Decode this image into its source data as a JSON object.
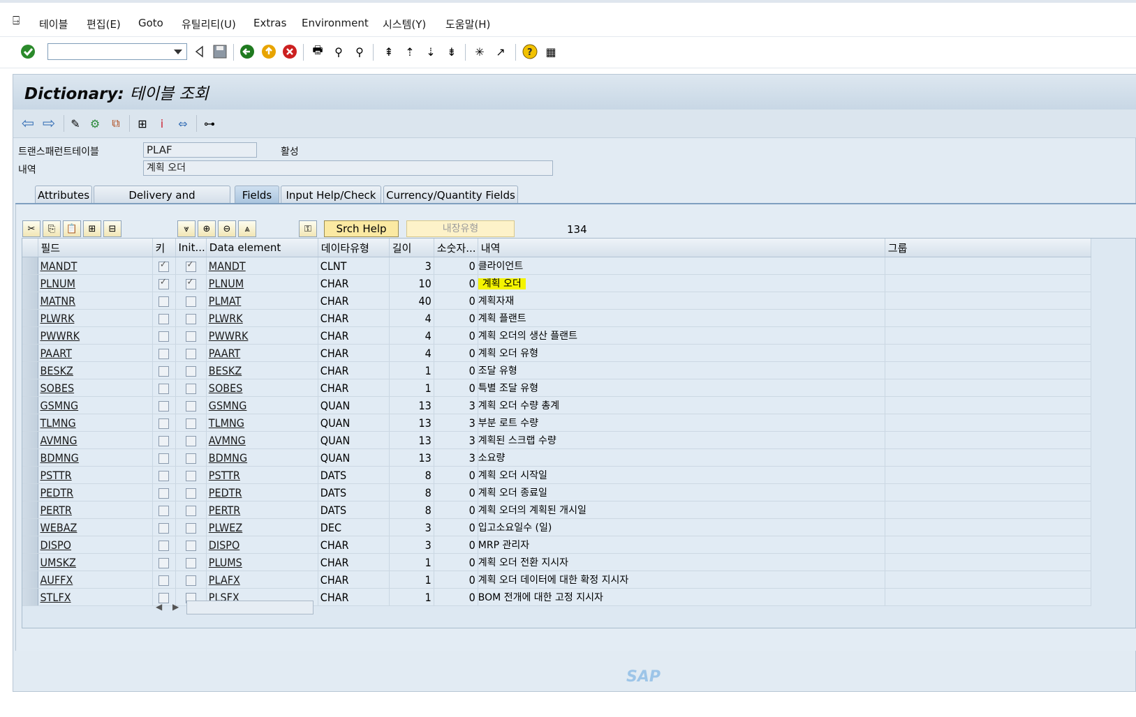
{
  "menu": {
    "items": [
      "테이블",
      "편집(E)",
      "Goto",
      "유틸리티(U)",
      "Extras",
      "Environment",
      "시스템(Y)",
      "도움말(H)"
    ]
  },
  "title": {
    "prefix": "Dictionary:",
    "text": "테이블 조회"
  },
  "header": {
    "table_label": "트랜스패런트테이블",
    "table_value": "PLAF",
    "status": "활성",
    "desc_label": "내역",
    "desc_value": "계획 오더"
  },
  "tabs": [
    {
      "label": "Attributes",
      "active": false
    },
    {
      "label": "Delivery and Maintenance",
      "active": false
    },
    {
      "label": "Fields",
      "active": true
    },
    {
      "label": "Input Help/Check",
      "active": false
    },
    {
      "label": "Currency/Quantity Fields",
      "active": false
    }
  ],
  "table_toolbar": {
    "srch_help": "Srch Help",
    "builtin_type": "내장유형",
    "count": "134"
  },
  "columns": [
    "필드",
    "키",
    "Init...",
    "Data element",
    "데이타유형",
    "길이",
    "소숫자...",
    "내역",
    "그룹"
  ],
  "rows": [
    {
      "field": "MANDT",
      "key": true,
      "init": true,
      "element": "MANDT",
      "type": "CLNT",
      "len": "3",
      "dec": "0",
      "desc": "클라이언트",
      "hl": false
    },
    {
      "field": "PLNUM",
      "key": true,
      "init": true,
      "element": "PLNUM",
      "type": "CHAR",
      "len": "10",
      "dec": "0",
      "desc": "계획 오더",
      "hl": true
    },
    {
      "field": "MATNR",
      "key": false,
      "init": false,
      "element": "PLMAT",
      "type": "CHAR",
      "len": "40",
      "dec": "0",
      "desc": "계획자재",
      "hl": false
    },
    {
      "field": "PLWRK",
      "key": false,
      "init": false,
      "element": "PLWRK",
      "type": "CHAR",
      "len": "4",
      "dec": "0",
      "desc": "계획 플랜트",
      "hl": false
    },
    {
      "field": "PWWRK",
      "key": false,
      "init": false,
      "element": "PWWRK",
      "type": "CHAR",
      "len": "4",
      "dec": "0",
      "desc": "계획 오더의 생산 플랜트",
      "hl": false
    },
    {
      "field": "PAART",
      "key": false,
      "init": false,
      "element": "PAART",
      "type": "CHAR",
      "len": "4",
      "dec": "0",
      "desc": "계획 오더 유형",
      "hl": false
    },
    {
      "field": "BESKZ",
      "key": false,
      "init": false,
      "element": "BESKZ",
      "type": "CHAR",
      "len": "1",
      "dec": "0",
      "desc": "조달 유형",
      "hl": false
    },
    {
      "field": "SOBES",
      "key": false,
      "init": false,
      "element": "SOBES",
      "type": "CHAR",
      "len": "1",
      "dec": "0",
      "desc": "특별 조달 유형",
      "hl": false
    },
    {
      "field": "GSMNG",
      "key": false,
      "init": false,
      "element": "GSMNG",
      "type": "QUAN",
      "len": "13",
      "dec": "3",
      "desc": "계획 오더 수량 총계",
      "hl": false
    },
    {
      "field": "TLMNG",
      "key": false,
      "init": false,
      "element": "TLMNG",
      "type": "QUAN",
      "len": "13",
      "dec": "3",
      "desc": "부분 로트 수량",
      "hl": false
    },
    {
      "field": "AVMNG",
      "key": false,
      "init": false,
      "element": "AVMNG",
      "type": "QUAN",
      "len": "13",
      "dec": "3",
      "desc": "계획된 스크랩 수량",
      "hl": false
    },
    {
      "field": "BDMNG",
      "key": false,
      "init": false,
      "element": "BDMNG",
      "type": "QUAN",
      "len": "13",
      "dec": "3",
      "desc": "소요량",
      "hl": false
    },
    {
      "field": "PSTTR",
      "key": false,
      "init": false,
      "element": "PSTTR",
      "type": "DATS",
      "len": "8",
      "dec": "0",
      "desc": "계획 오더 시작일",
      "hl": false
    },
    {
      "field": "PEDTR",
      "key": false,
      "init": false,
      "element": "PEDTR",
      "type": "DATS",
      "len": "8",
      "dec": "0",
      "desc": "계획 오더 종료일",
      "hl": false
    },
    {
      "field": "PERTR",
      "key": false,
      "init": false,
      "element": "PERTR",
      "type": "DATS",
      "len": "8",
      "dec": "0",
      "desc": "계획 오더의 계획된 개시일",
      "hl": false
    },
    {
      "field": "WEBAZ",
      "key": false,
      "init": false,
      "element": "PLWEZ",
      "type": "DEC",
      "len": "3",
      "dec": "0",
      "desc": "입고소요일수 (일)",
      "hl": false
    },
    {
      "field": "DISPO",
      "key": false,
      "init": false,
      "element": "DISPO",
      "type": "CHAR",
      "len": "3",
      "dec": "0",
      "desc": "MRP 관리자",
      "hl": false
    },
    {
      "field": "UMSKZ",
      "key": false,
      "init": false,
      "element": "PLUMS",
      "type": "CHAR",
      "len": "1",
      "dec": "0",
      "desc": "계획 오더 전환 지시자",
      "hl": false
    },
    {
      "field": "AUFFX",
      "key": false,
      "init": false,
      "element": "PLAFX",
      "type": "CHAR",
      "len": "1",
      "dec": "0",
      "desc": "계획 오더 데이터에 대한 확정 지시자",
      "hl": false
    },
    {
      "field": "STLFX",
      "key": false,
      "init": false,
      "element": "PLSFX",
      "type": "CHAR",
      "len": "1",
      "dec": "0",
      "desc": "BOM 전개에 대한 고정 지시자",
      "hl": false
    }
  ],
  "footer": {
    "logo": "SAP"
  }
}
